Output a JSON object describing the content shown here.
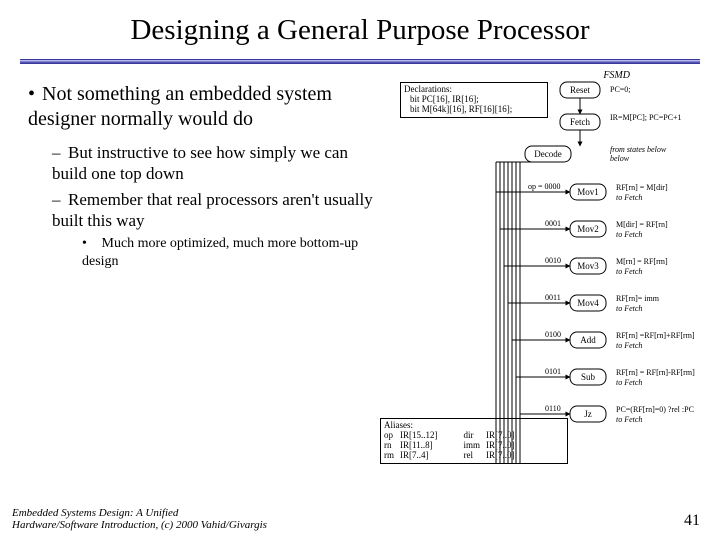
{
  "title": "Designing a General Purpose Processor",
  "bullets": {
    "b1": "Not something an embedded system designer normally would do",
    "b2a": "But instructive to see how simply we can build one top down",
    "b2b": "Remember that real processors aren't usually built this way",
    "b3": "Much more optimized, much more bottom-up design"
  },
  "decl": {
    "title": "Declarations:",
    "l1": "bit PC[16], IR[16];",
    "l2": "bit M[64k][16], RF[16][16];"
  },
  "aliases": {
    "title": "Aliases:",
    "rows": [
      [
        "op",
        "IR[15..12]"
      ],
      [
        "rn",
        "IR[11..8]"
      ],
      [
        "rm",
        "IR[7..4]"
      ]
    ],
    "rows2": [
      [
        "dir",
        "IR[7..0]"
      ],
      [
        "imm",
        "IR[7..0]"
      ],
      [
        "rel",
        "IR[7..0]"
      ]
    ]
  },
  "fsmd": {
    "label": "FSMD",
    "nodes": {
      "reset": "Reset",
      "fetch": "Fetch",
      "decode": "Decode",
      "mov1": "Mov1",
      "mov2": "Mov2",
      "mov3": "Mov3",
      "mov4": "Mov4",
      "add": "Add",
      "sub": "Sub",
      "jz": "Jz"
    },
    "ops": {
      "op0000": "op = 0000",
      "op0001": "0001",
      "op0010": "0010",
      "op0011": "0011",
      "op0100": "0100",
      "op0101": "0101",
      "op0110": "0110"
    },
    "actions": {
      "reset": "PC=0;",
      "fetch": "IR=M[PC]; PC=PC+1",
      "from": "from states below",
      "mov1a": "RF[rn] = M[dir]",
      "mov1b": "to Fetch",
      "mov2a": "M[dir] = RF[rn]",
      "mov2b": "to Fetch",
      "mov3a": "M[rn] = RF[rm]",
      "mov3b": "to Fetch",
      "mov4a": "RF[rn]= imm",
      "mov4b": "to Fetch",
      "adda": "RF[rn] =RF[rn]+RF[rm]",
      "addb": "to Fetch",
      "suba": "RF[rn] = RF[rn]-RF[rm]",
      "subb": "to Fetch",
      "jza": "PC=(RF[rn]=0) ?rel :PC",
      "jzb": "to Fetch"
    }
  },
  "footer": {
    "l1": "Embedded Systems Design: A Unified",
    "l2": "Hardware/Software Introduction, (c) 2000 Vahid/Givargis"
  },
  "pagenum": "41"
}
